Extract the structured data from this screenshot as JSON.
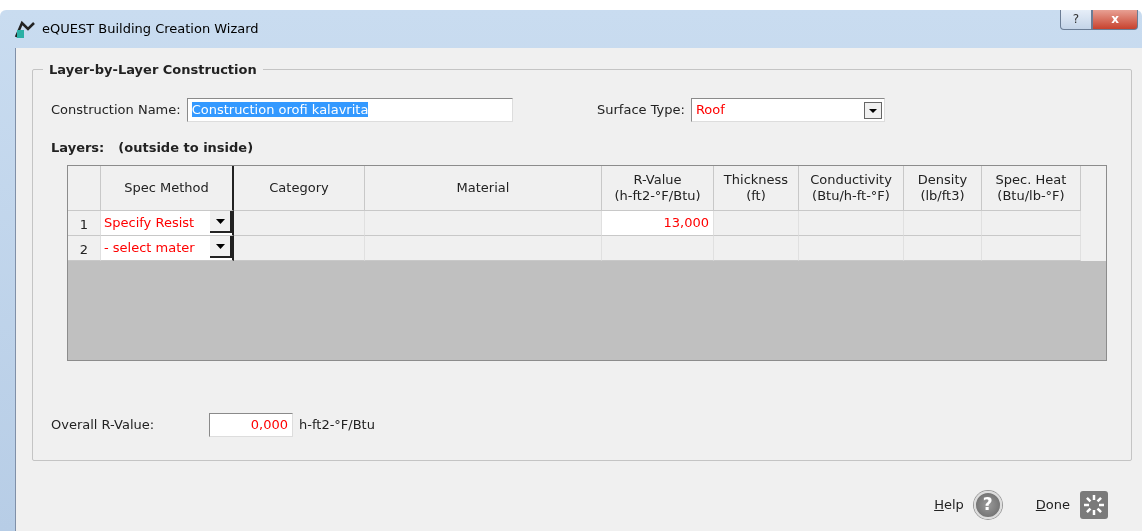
{
  "window": {
    "title": "eQUEST Building Creation Wizard",
    "help_glyph": "?",
    "close_glyph": "x"
  },
  "group": {
    "title": "Layer-by-Layer Construction"
  },
  "construction_name": {
    "label": "Construction Name:",
    "value": "Construction orofi kalavrita",
    "selected": true
  },
  "surface_type": {
    "label": "Surface Type:",
    "value": "Roof"
  },
  "layers": {
    "title": "Layers:",
    "subtitle": "(outside to inside)",
    "columns": [
      {
        "label": "Spec Method"
      },
      {
        "label": "Category"
      },
      {
        "label": "Material"
      },
      {
        "label": "R-Value",
        "unit": "(h-ft2-°F/Btu)"
      },
      {
        "label": "Thickness",
        "unit": "(ft)"
      },
      {
        "label": "Conductivity",
        "unit": "(Btu/h-ft-°F)"
      },
      {
        "label": "Density",
        "unit": "(lb/ft3)"
      },
      {
        "label": "Spec. Heat",
        "unit": "(Btu/lb-°F)"
      }
    ],
    "rows": [
      {
        "number": "1",
        "spec_method": "Specify Resist",
        "r_value": "13,000"
      },
      {
        "number": "2",
        "spec_method": "- select mater"
      }
    ]
  },
  "overall": {
    "label": "Overall R-Value:",
    "value": "0,000",
    "unit": "h-ft2-°F/Btu"
  },
  "buttons": [
    {
      "kind": "help",
      "label": "Help",
      "glyph": "?"
    },
    {
      "kind": "done",
      "label": "Done"
    }
  ]
}
